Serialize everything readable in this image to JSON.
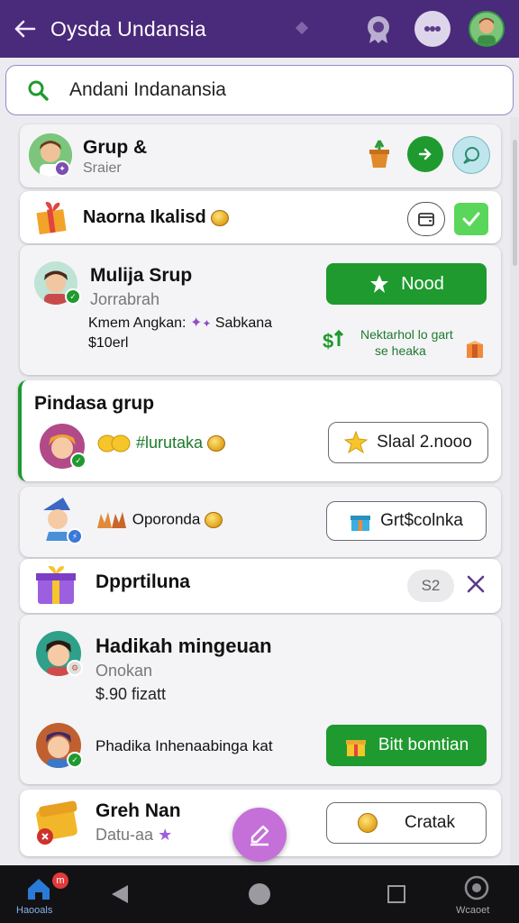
{
  "header": {
    "title": "Oysda Undansia"
  },
  "search": {
    "text": "Andani Indanansia"
  },
  "cards": {
    "grup": {
      "title": "Grup &",
      "subtitle": "Sraier"
    },
    "naorna": {
      "title": "Naorna Ikalisd"
    },
    "mulija": {
      "title": "Mulija Srup",
      "subtitle": "Jorrabrah",
      "line1_a": "Kmem Angkan:",
      "line1_b": "Sabkana",
      "line2": "$10erl",
      "button": "Nood",
      "side_top": "Nektarhol lo gart",
      "side_bottom": "se heaka"
    },
    "pindasa": {
      "title": "Pindasa grup",
      "label": "#lurutaka",
      "button": "Slaal 2.nooo"
    },
    "oporda": {
      "label": "Oporonda",
      "button": "Grt$colnka"
    },
    "dpprtiluna": {
      "title": "Dpprtiluna",
      "badge": "S2"
    },
    "hadikah": {
      "title": "Hadikah mingeuan",
      "subtitle": "Onokan",
      "price": "$.90 fizatt"
    },
    "phadika": {
      "text": "Phadika Inhenaabinga kat",
      "button": "Bitt bomtian"
    },
    "greh": {
      "title": "Greh Nan",
      "subtitle": "Datu-aa",
      "button": "Cratak"
    }
  },
  "nav": {
    "home_label": "Haooals",
    "home_badge": "m",
    "right_label": "Wcaoet"
  },
  "colors": {
    "header": "#4a2a7a",
    "green": "#1e9a2e",
    "accent": "#c56fd9"
  }
}
